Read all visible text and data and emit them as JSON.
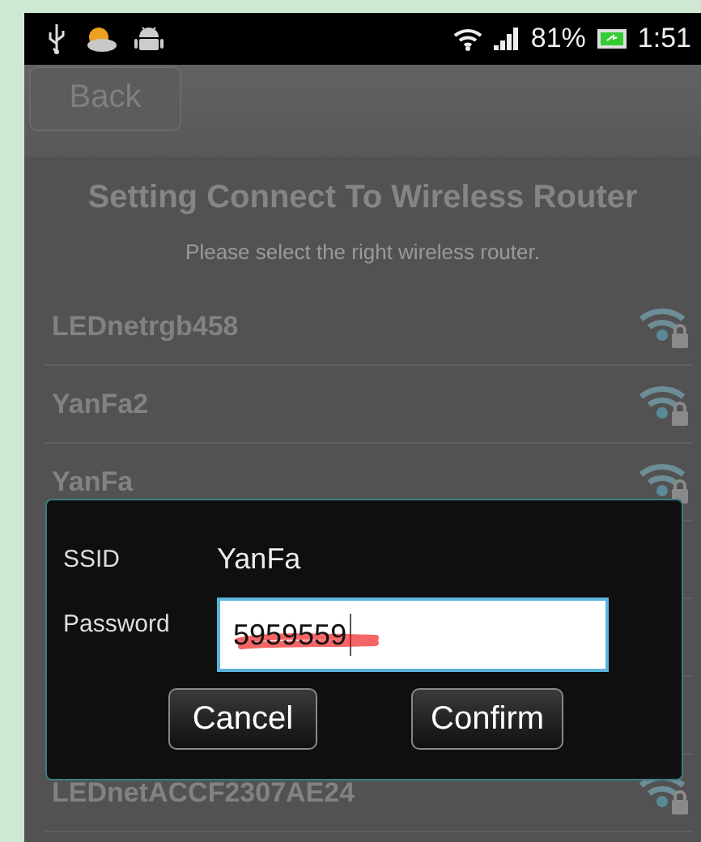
{
  "status_bar": {
    "battery_percent": "81%",
    "time": "1:51"
  },
  "toolbar": {
    "back_button": "Back"
  },
  "title": "Setting Connect To Wireless Router",
  "subtitle": "Please select the right wireless router.",
  "networks_above_dialog": [
    {
      "name": "LEDnetrgb458"
    },
    {
      "name": "YanFa2"
    },
    {
      "name": "YanFa"
    }
  ],
  "networks_below_dialog": [
    {
      "name": "LEDnetACCF2307AE24"
    }
  ],
  "dialog": {
    "ssid_label": "SSID",
    "ssid_value": "YanFa",
    "password_label": "Password",
    "password_value": "5959559",
    "buttons": [
      "Cancel",
      "Confirm"
    ]
  }
}
